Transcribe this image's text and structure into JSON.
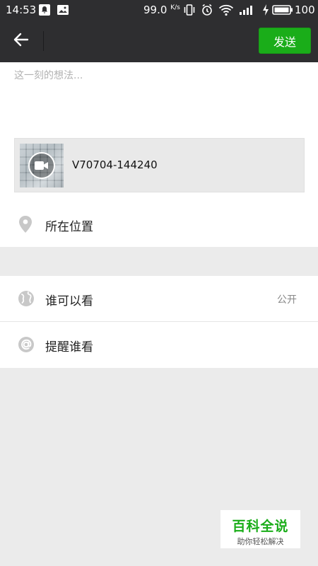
{
  "status_bar": {
    "time": "14:53",
    "network_speed": "99.0",
    "speed_unit": "K/s",
    "battery": "100"
  },
  "top_bar": {
    "send_label": "发送"
  },
  "compose": {
    "placeholder": "这一刻的想法...",
    "video_name": "V70704-144240",
    "location_label": "所在位置"
  },
  "settings": {
    "visibility_label": "谁可以看",
    "visibility_value": "公开",
    "remind_label": "提醒谁看"
  },
  "watermark": {
    "title": "百科全说",
    "subtitle": "助你轻松解决"
  },
  "colors": {
    "accent": "#1aad19",
    "header_bg": "#2e2e30",
    "page_bg": "#ebebeb"
  },
  "icons": [
    "arrow-left-icon",
    "video-camera-icon",
    "location-pin-icon",
    "globe-icon",
    "at-sign-icon"
  ]
}
